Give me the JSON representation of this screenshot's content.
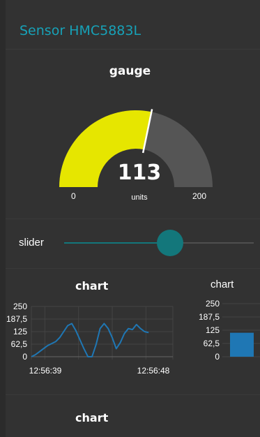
{
  "header": {
    "title": "Sensor HMC5883L"
  },
  "gauge": {
    "label": "gauge",
    "value": 113,
    "value_text": "113",
    "units": "units",
    "min": 0,
    "max": 200,
    "min_text": "0",
    "max_text": "200",
    "fill_color": "#e6e600",
    "track_color": "#555555"
  },
  "slider": {
    "label": "slider",
    "value": 0.56,
    "color": "#13777b"
  },
  "chart_data": [
    {
      "type": "line",
      "title": "chart",
      "y_ticks": [
        "250",
        "187,5",
        "125",
        "62,5",
        "0"
      ],
      "ylim": [
        0,
        250
      ],
      "x_ticks": [
        "12:56:39",
        "12:56:48"
      ],
      "series": [
        {
          "color": "#1f77b4",
          "x": [
            0,
            0.3,
            0.6,
            0.9,
            1.2,
            1.5,
            1.8,
            2.1,
            2.4,
            2.7,
            3.0,
            3.3,
            3.6,
            3.9,
            4.2,
            4.5,
            4.8,
            5.1,
            5.4,
            5.7,
            6.0,
            6.3,
            6.6,
            6.9,
            7.2,
            7.5,
            7.8,
            8.1,
            8.4,
            8.7
          ],
          "y": [
            0,
            10,
            25,
            40,
            55,
            65,
            75,
            95,
            125,
            155,
            165,
            130,
            85,
            40,
            0,
            0,
            60,
            140,
            165,
            140,
            95,
            40,
            70,
            115,
            140,
            135,
            160,
            140,
            125,
            120
          ]
        }
      ]
    },
    {
      "type": "bar",
      "title": "chart",
      "y_ticks": [
        "250",
        "187,5",
        "125",
        "62,5",
        "0"
      ],
      "ylim": [
        0,
        250
      ],
      "categories": [
        ""
      ],
      "values": [
        113
      ],
      "color": "#1f77b4"
    },
    {
      "type": "line",
      "title": "chart"
    }
  ]
}
